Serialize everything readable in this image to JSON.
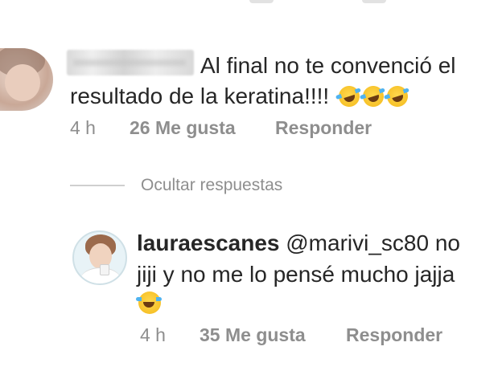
{
  "comment1": {
    "text_line1": "Al final no te convenció el",
    "text_line2": "resultado de la keratina!!!!",
    "emoji": "rolling-on-floor-laughing-emoji",
    "meta": {
      "time": "4 h",
      "likes": "26 Me gusta",
      "reply": "Responder"
    }
  },
  "replies_toggle": {
    "label": "Ocultar respuestas"
  },
  "comment2": {
    "username": "lauraescanes",
    "mention": "@marivi_sc80",
    "text_after_mention": " no",
    "text_line2": "jiji y no me lo pensé mucho jajja",
    "emoji": "tears-of-joy-emoji",
    "meta": {
      "time": "4 h",
      "likes": "35 Me gusta",
      "reply": "Responder"
    }
  }
}
